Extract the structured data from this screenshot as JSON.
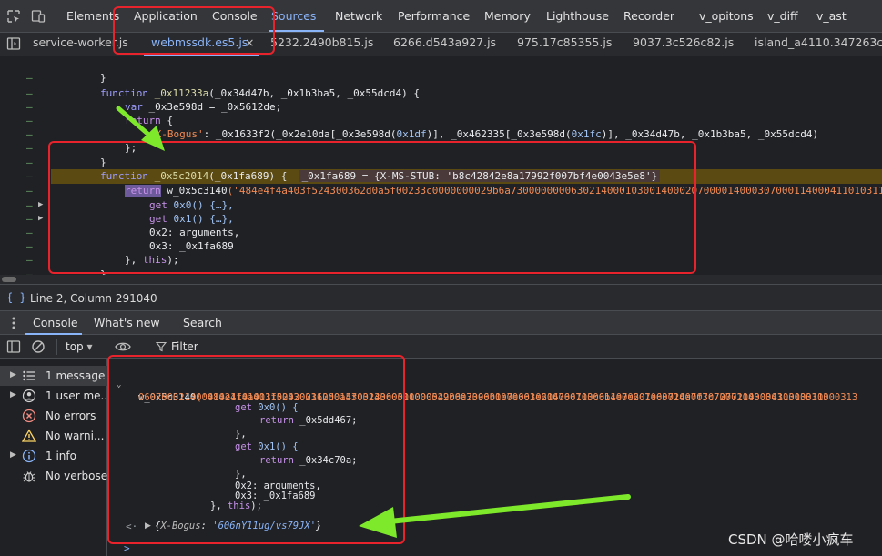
{
  "main_tabs": [
    {
      "label": "Elements"
    },
    {
      "label": "Application"
    },
    {
      "label": "Console"
    },
    {
      "label": "Sources"
    },
    {
      "label": "Network"
    },
    {
      "label": "Performance"
    },
    {
      "label": "Memory"
    },
    {
      "label": "Lighthouse"
    },
    {
      "label": "Recorder"
    },
    {
      "label": "v_opitons"
    },
    {
      "label": "v_diff"
    },
    {
      "label": "v_ast"
    }
  ],
  "file_tabs": [
    {
      "label": "service-worker.js"
    },
    {
      "label": "webmssdk.es5.js"
    },
    {
      "label": "5232.2490b815.js"
    },
    {
      "label": "6266.d543a927.js"
    },
    {
      "label": "975.17c85355.js"
    },
    {
      "label": "9037.3c526c82.js"
    },
    {
      "label": "island_a4110.347263c1."
    }
  ],
  "close_glyph": "×",
  "code": {
    "l1": "}",
    "l2_kw": "function",
    "l2_name": "_0x11233a",
    "l2_params": "(_0x34d47b, _0x1b3ba5, _0x55dcd4) {",
    "l3_kw": "var",
    "l3_rest": "_0x3e598d = _0x5612de;",
    "l4_kw": "return",
    "l4_rest": "{",
    "l5_key": "'X-Bogus'",
    "l5_a": ": _0x1633f2(_0x2e10da[_0x3e598d(",
    "l5_n1": "0x1df",
    "l5_b": ")], _0x462335[_0x3e598d(",
    "l5_n2": "0x1fc",
    "l5_c": ")], _0x34d47b, _0x1b3ba5, _0x55dcd4)",
    "l6": "};",
    "l7": "}",
    "l8_kw": "function",
    "l8_name": "_0x5c2014",
    "l8_params": "(_0x1fa689) {",
    "l8_inline": "_0x1fa689 = {X-MS-STUB: 'b8c42842e8a17992f007bf4e0043e5e8'}",
    "l9_kw": "return",
    "l9_fn": "w_0x5c3140",
    "l9_str": "('484e4f4a403f524300362d0a5f00233c0000000029b6a73000000006302140001030014000207000014000307000114000411010311000",
    "l10_kw": "get",
    "l10_rest": "0x0() {…},",
    "l11_kw": "get",
    "l11_rest": "0x1() {…},",
    "l12": "0x2: arguments,",
    "l13": "0x3: _0x1fa689",
    "l14_a": "},",
    "l14_kw": "this",
    "l14_b": ");",
    "l15": "}"
  },
  "status": {
    "braces": "{ }",
    "position": "Line 2, Column 291040"
  },
  "drawer_tabs": [
    {
      "label": "Console"
    },
    {
      "label": "What's new"
    },
    {
      "label": "Search"
    }
  ],
  "toolbar": {
    "context": "top",
    "context_arrow": "▾",
    "filter_placeholder": "Filter"
  },
  "sidebar": [
    {
      "label": "1 message"
    },
    {
      "label": "1 user me..."
    },
    {
      "label": "No errors"
    },
    {
      "label": "No warni..."
    },
    {
      "label": "1 info"
    },
    {
      "label": "No verbose"
    }
  ],
  "console": {
    "o1_fn": "w_0x5c3140",
    "o1_str": "('484e4f4a403f524300362d0a5f00233c0000000029b6a73000000006302140001030014000207000014000307000114000411010311000313",
    "o2_str": "0607000214000102110101110002021100014303140005110005420003096b1e7e601e606766710c6b1e7e601e63726a7f7c72772003030303030303",
    "o3_kw": "get",
    "o3_rest": "0x0() {",
    "o4_kw": "return",
    "o4_rest": "_0x5dd467;",
    "o5": "},",
    "o6_kw": "get",
    "o6_rest": "0x1() {",
    "o7_kw": "return",
    "o7_rest": "_0x34c70a;",
    "o8": "},",
    "o9": "0x2: arguments,",
    "o10": "0x3: _0x1fa689",
    "o11_a": "},",
    "o11_kw": "this",
    "o11_b": ");",
    "back_arrow": "<·",
    "result_open": "{",
    "result_key": "X-Bogus",
    "result_colon": ": ",
    "result_value": "'606nY11ug/vs79JX'",
    "result_close": "}",
    "prompt": ">"
  },
  "watermark": "CSDN @哈喽小疯车",
  "colors": {
    "accent": "#8ab4f8",
    "annotation_red": "#e8232c",
    "annotation_green": "#7ee82a",
    "pause_highlight": "#5b4a12"
  }
}
